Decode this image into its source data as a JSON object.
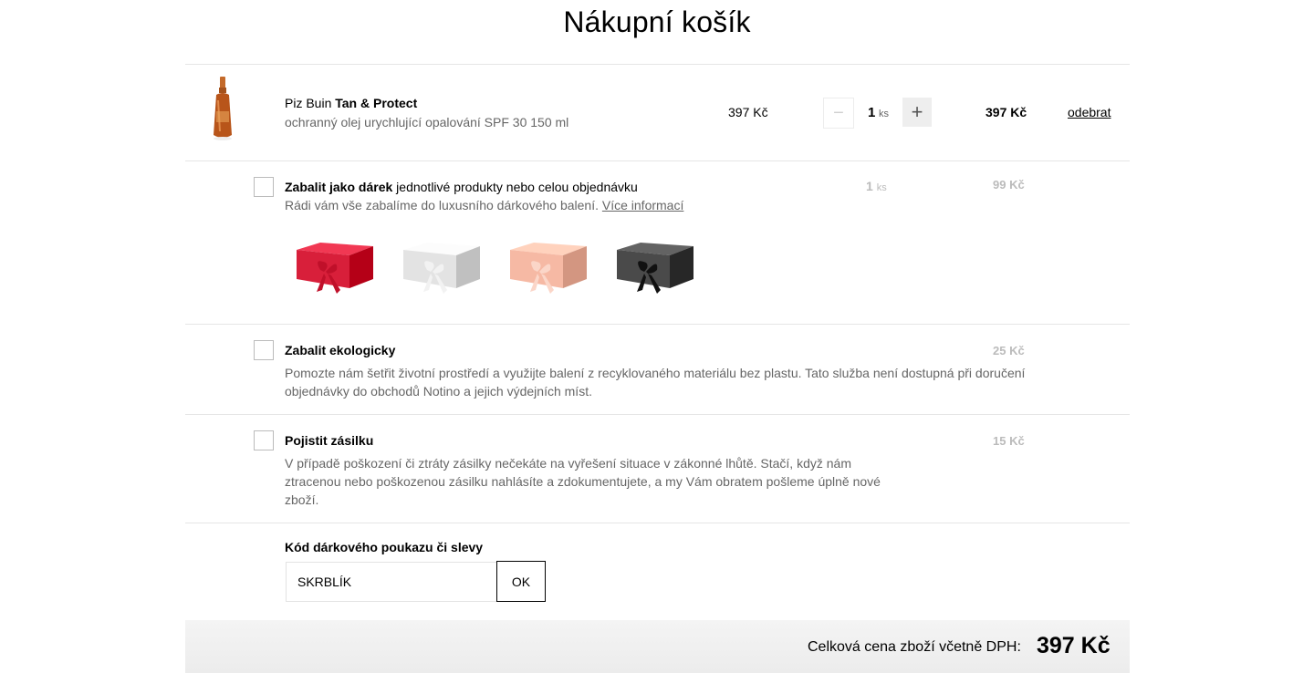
{
  "page": {
    "title": "Nákupní košík"
  },
  "product": {
    "brand": "Piz Buin",
    "name": "Tan & Protect",
    "description": "ochranný olej urychlující opalování SPF 30 150 ml",
    "unit_price": "397 Kč",
    "quantity": "1",
    "quantity_unit": "ks",
    "total_price": "397 Kč",
    "remove_label": "odebrat",
    "minus_label": "−",
    "plus_label": "+"
  },
  "gift_wrap": {
    "title_bold": "Zabalit jako dárek",
    "title_rest": " jednotlivé produkty nebo celou objednávku",
    "description": "Rádi vám vše zabalíme do luxusního dárkového balení. ",
    "more_info_link": "Více informací",
    "quantity": "1",
    "quantity_unit": "ks",
    "price": "99 Kč",
    "box_colors": [
      "#d81f3a",
      "#e3e3e3",
      "#f6b9a4",
      "#4a4a4a"
    ],
    "ribbon_colors": [
      "#c0102a",
      "#f2f2f2",
      "#fbd6c8",
      "#111111"
    ]
  },
  "eco_wrap": {
    "title": "Zabalit ekologicky",
    "description_line1": "Pomozte nám šetřit životní prostředí a využijte balení z recyklovaného materiálu bez plastu. Tato služba není dostupná při doručení",
    "description_line2": "objednávky do obchodů Notino a jejich výdejních míst.",
    "price": "25 Kč"
  },
  "insurance": {
    "title": "Pojistit zásilku",
    "description_line1": "V případě poškození či ztráty zásilky nečekáte na vyřešení situace v zákonné lhůtě. Stačí, když nám",
    "description_line2": "ztracenou nebo poškozenou zásilku nahlásíte a zdokumentujete, a my Vám obratem pošleme úplně nové",
    "description_line3": "zboží.",
    "price": "15 Kč"
  },
  "voucher": {
    "label": "Kód dárkového poukazu či slevy",
    "value": "SKRBLÍK",
    "button": "OK"
  },
  "summary": {
    "label": "Celková cena zboží včetně DPH:",
    "total": "397 Kč"
  }
}
